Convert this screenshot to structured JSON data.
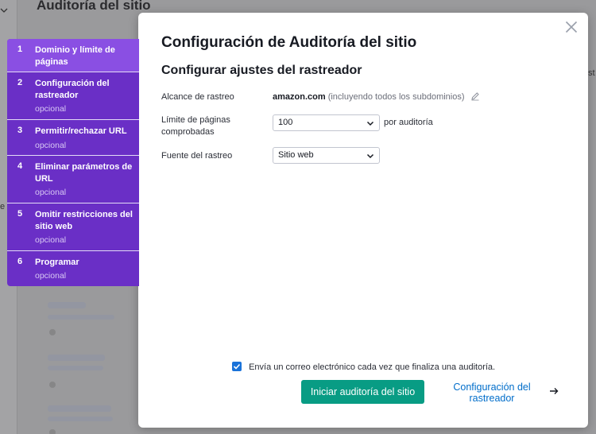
{
  "background": {
    "page_title": "Auditoría del sitio",
    "left_partial_text": "e",
    "right_partial_text": "st"
  },
  "modal": {
    "title": "Configuración de Auditoría del sitio",
    "section_title": "Configurar ajustes del rastreador",
    "close_icon": "close-icon",
    "fields": {
      "scope": {
        "label": "Alcance de rastreo",
        "domain": "amazon.com",
        "note": "(incluyendo todos los subdominios)",
        "edit_icon": "pencil-icon"
      },
      "page_limit": {
        "label": "Límite de páginas comprobadas",
        "value": "100",
        "suffix": "por auditoría"
      },
      "source": {
        "label": "Fuente del rastreo",
        "value": "Sitio web"
      }
    },
    "email_checkbox": {
      "checked": true,
      "label": "Envía un correo electrónico cada vez que finaliza una auditoría."
    },
    "start_button": "Iniciar auditoría del sitio",
    "next_link": "Configuración del rastreador",
    "next_icon": "arrow-right-icon"
  },
  "steps": [
    {
      "num": "1",
      "label": "Dominio y límite de páginas",
      "sub": "",
      "active": true
    },
    {
      "num": "2",
      "label": "Configuración del rastreador",
      "sub": "opcional",
      "active": false
    },
    {
      "num": "3",
      "label": "Permitir/rechazar URL",
      "sub": "opcional",
      "active": false
    },
    {
      "num": "4",
      "label": "Eliminar parámetros de URL",
      "sub": "opcional",
      "active": false
    },
    {
      "num": "5",
      "label": "Omitir restricciones del sitio web",
      "sub": "opcional",
      "active": false
    },
    {
      "num": "6",
      "label": "Programar",
      "sub": "opcional",
      "active": false
    }
  ],
  "colors": {
    "steps_bg": "#6a2fc6",
    "step_active_bg": "#8a4fe3",
    "primary_button": "#089c84",
    "link": "#006dca",
    "checkbox": "#1a73d9"
  }
}
